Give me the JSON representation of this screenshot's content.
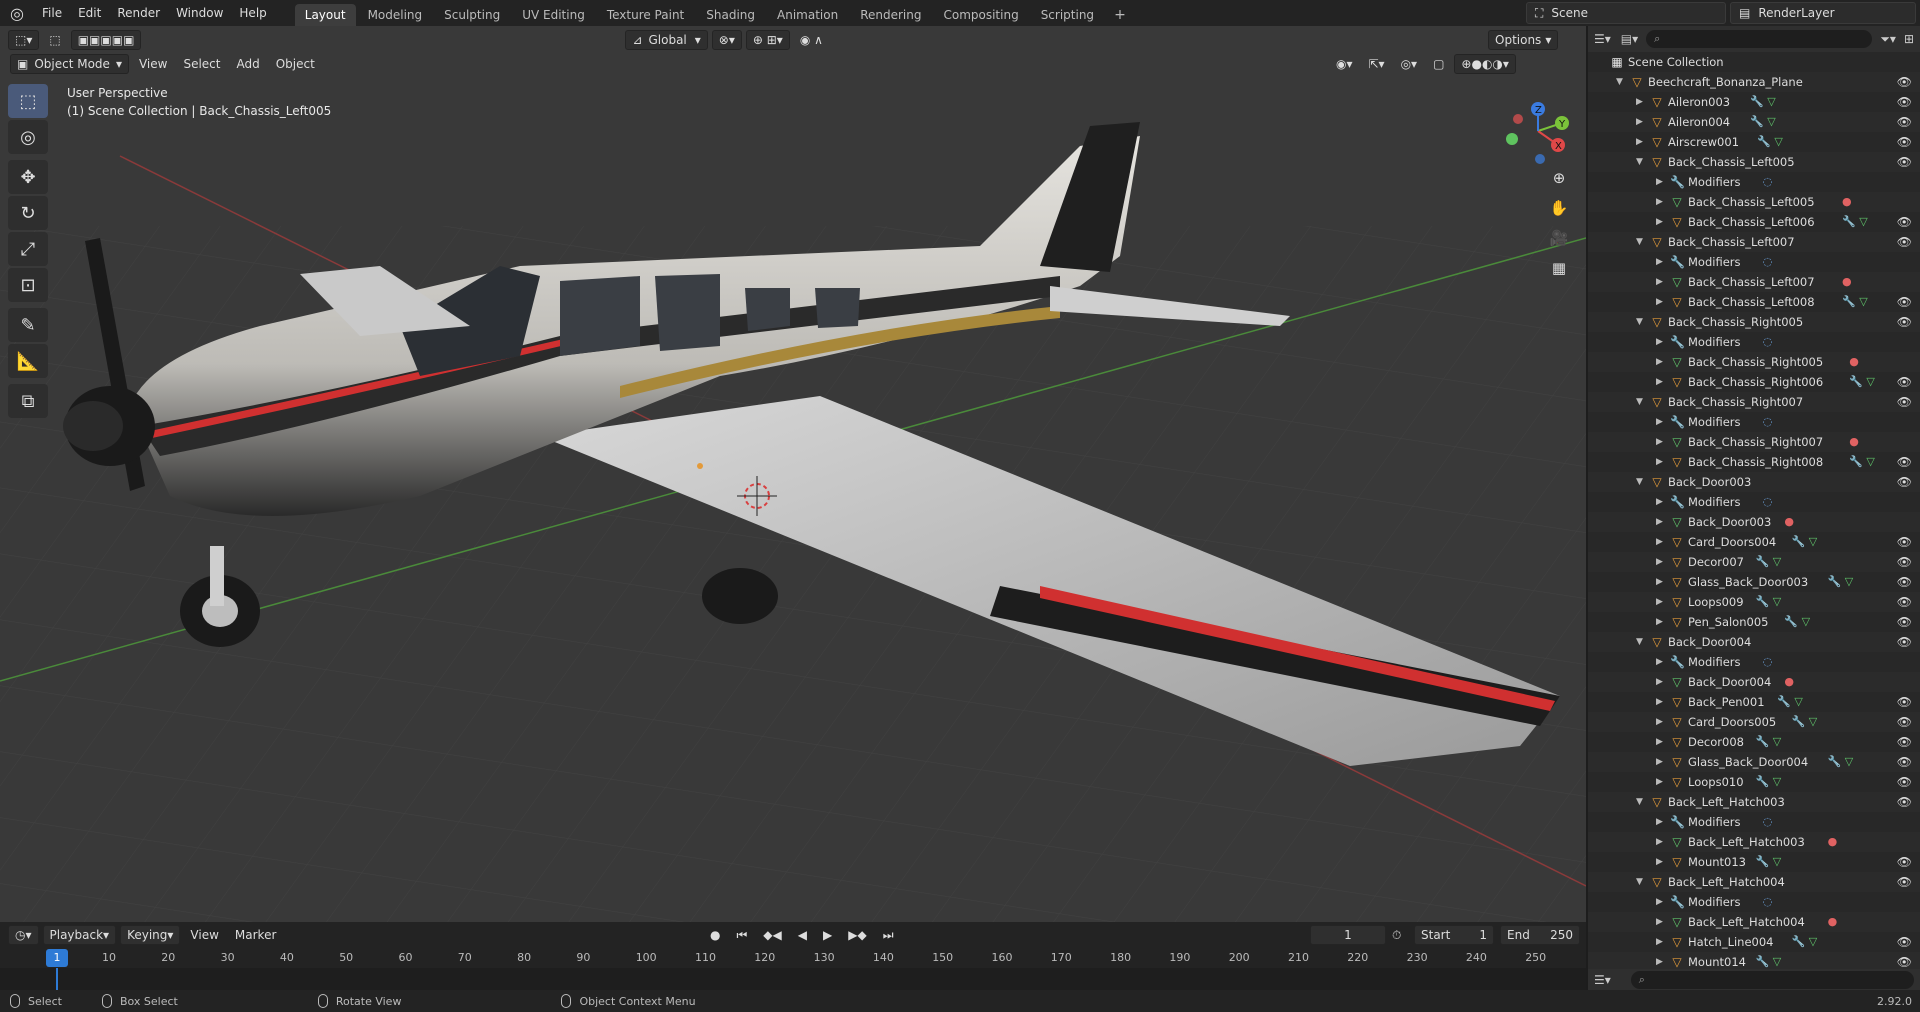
{
  "topbar": {
    "menus": [
      "File",
      "Edit",
      "Render",
      "Window",
      "Help"
    ],
    "workspaces": [
      "Layout",
      "Modeling",
      "Sculpting",
      "UV Editing",
      "Texture Paint",
      "Shading",
      "Animation",
      "Rendering",
      "Compositing",
      "Scripting"
    ],
    "active_workspace": "Layout",
    "scene": "Scene",
    "render_layer": "RenderLayer"
  },
  "viewport": {
    "mode": "Object Mode",
    "menus": [
      "View",
      "Select",
      "Add",
      "Object"
    ],
    "transform_orientation": "Global",
    "options_label": "Options",
    "perspective_label": "User Perspective",
    "context_label": "(1) Scene Collection | Back_Chassis_Left005",
    "gizmo_axes": [
      "X",
      "Y",
      "Z"
    ]
  },
  "outliner": {
    "search_placeholder": "",
    "rows": [
      {
        "depth": 0,
        "type": "coll",
        "expand": "",
        "label": "Scene Collection",
        "eye": false,
        "mods": ""
      },
      {
        "depth": 1,
        "type": "obj",
        "expand": "open",
        "label": "Beechcraft_Bonanza_Plane",
        "eye": true,
        "mods": ""
      },
      {
        "depth": 2,
        "type": "obj",
        "expand": "closed",
        "label": "Aileron003",
        "eye": true,
        "mods": "wrench+mesh"
      },
      {
        "depth": 2,
        "type": "obj",
        "expand": "closed",
        "label": "Aileron004",
        "eye": true,
        "mods": "wrench+mesh"
      },
      {
        "depth": 2,
        "type": "obj",
        "expand": "closed",
        "label": "Airscrew001",
        "eye": true,
        "mods": "wrench+mesh"
      },
      {
        "depth": 2,
        "type": "obj",
        "expand": "open",
        "label": "Back_Chassis_Left005",
        "eye": true,
        "mods": ""
      },
      {
        "depth": 3,
        "type": "mod",
        "expand": "closed",
        "label": "Modifiers",
        "eye": false,
        "mods": "mod"
      },
      {
        "depth": 3,
        "type": "mesh",
        "expand": "closed",
        "label": "Back_Chassis_Left005",
        "eye": false,
        "mods": "mat"
      },
      {
        "depth": 3,
        "type": "obj",
        "expand": "closed",
        "label": "Back_Chassis_Left006",
        "eye": true,
        "mods": "wrench+mesh"
      },
      {
        "depth": 2,
        "type": "obj",
        "expand": "open",
        "label": "Back_Chassis_Left007",
        "eye": true,
        "mods": ""
      },
      {
        "depth": 3,
        "type": "mod",
        "expand": "closed",
        "label": "Modifiers",
        "eye": false,
        "mods": "mod"
      },
      {
        "depth": 3,
        "type": "mesh",
        "expand": "closed",
        "label": "Back_Chassis_Left007",
        "eye": false,
        "mods": "mat"
      },
      {
        "depth": 3,
        "type": "obj",
        "expand": "closed",
        "label": "Back_Chassis_Left008",
        "eye": true,
        "mods": "wrench+mesh"
      },
      {
        "depth": 2,
        "type": "obj",
        "expand": "open",
        "label": "Back_Chassis_Right005",
        "eye": true,
        "mods": ""
      },
      {
        "depth": 3,
        "type": "mod",
        "expand": "closed",
        "label": "Modifiers",
        "eye": false,
        "mods": "mod"
      },
      {
        "depth": 3,
        "type": "mesh",
        "expand": "closed",
        "label": "Back_Chassis_Right005",
        "eye": false,
        "mods": "mat"
      },
      {
        "depth": 3,
        "type": "obj",
        "expand": "closed",
        "label": "Back_Chassis_Right006",
        "eye": true,
        "mods": "wrench+mesh"
      },
      {
        "depth": 2,
        "type": "obj",
        "expand": "open",
        "label": "Back_Chassis_Right007",
        "eye": true,
        "mods": ""
      },
      {
        "depth": 3,
        "type": "mod",
        "expand": "closed",
        "label": "Modifiers",
        "eye": false,
        "mods": "mod"
      },
      {
        "depth": 3,
        "type": "mesh",
        "expand": "closed",
        "label": "Back_Chassis_Right007",
        "eye": false,
        "mods": "mat"
      },
      {
        "depth": 3,
        "type": "obj",
        "expand": "closed",
        "label": "Back_Chassis_Right008",
        "eye": true,
        "mods": "wrench+mesh"
      },
      {
        "depth": 2,
        "type": "obj",
        "expand": "open",
        "label": "Back_Door003",
        "eye": true,
        "mods": ""
      },
      {
        "depth": 3,
        "type": "mod",
        "expand": "closed",
        "label": "Modifiers",
        "eye": false,
        "mods": "mod"
      },
      {
        "depth": 3,
        "type": "mesh",
        "expand": "closed",
        "label": "Back_Door003",
        "eye": false,
        "mods": "mat"
      },
      {
        "depth": 3,
        "type": "obj",
        "expand": "closed",
        "label": "Card_Doors004",
        "eye": true,
        "mods": "wrench+mesh"
      },
      {
        "depth": 3,
        "type": "obj",
        "expand": "closed",
        "label": "Decor007",
        "eye": true,
        "mods": "wrench+mesh"
      },
      {
        "depth": 3,
        "type": "obj",
        "expand": "closed",
        "label": "Glass_Back_Door003",
        "eye": true,
        "mods": "wrench+mesh"
      },
      {
        "depth": 3,
        "type": "obj",
        "expand": "closed",
        "label": "Loops009",
        "eye": true,
        "mods": "wrench+mesh"
      },
      {
        "depth": 3,
        "type": "obj",
        "expand": "closed",
        "label": "Pen_Salon005",
        "eye": true,
        "mods": "wrench+mesh"
      },
      {
        "depth": 2,
        "type": "obj",
        "expand": "open",
        "label": "Back_Door004",
        "eye": true,
        "mods": ""
      },
      {
        "depth": 3,
        "type": "mod",
        "expand": "closed",
        "label": "Modifiers",
        "eye": false,
        "mods": "mod"
      },
      {
        "depth": 3,
        "type": "mesh",
        "expand": "closed",
        "label": "Back_Door004",
        "eye": false,
        "mods": "mat"
      },
      {
        "depth": 3,
        "type": "obj",
        "expand": "closed",
        "label": "Back_Pen001",
        "eye": true,
        "mods": "wrench+mesh"
      },
      {
        "depth": 3,
        "type": "obj",
        "expand": "closed",
        "label": "Card_Doors005",
        "eye": true,
        "mods": "wrench+mesh"
      },
      {
        "depth": 3,
        "type": "obj",
        "expand": "closed",
        "label": "Decor008",
        "eye": true,
        "mods": "wrench+mesh"
      },
      {
        "depth": 3,
        "type": "obj",
        "expand": "closed",
        "label": "Glass_Back_Door004",
        "eye": true,
        "mods": "wrench+mesh"
      },
      {
        "depth": 3,
        "type": "obj",
        "expand": "closed",
        "label": "Loops010",
        "eye": true,
        "mods": "wrench+mesh"
      },
      {
        "depth": 2,
        "type": "obj",
        "expand": "open",
        "label": "Back_Left_Hatch003",
        "eye": true,
        "mods": ""
      },
      {
        "depth": 3,
        "type": "mod",
        "expand": "closed",
        "label": "Modifiers",
        "eye": false,
        "mods": "mod"
      },
      {
        "depth": 3,
        "type": "mesh",
        "expand": "closed",
        "label": "Back_Left_Hatch003",
        "eye": false,
        "mods": "mat"
      },
      {
        "depth": 3,
        "type": "obj",
        "expand": "closed",
        "label": "Mount013",
        "eye": true,
        "mods": "wrench+mesh"
      },
      {
        "depth": 2,
        "type": "obj",
        "expand": "open",
        "label": "Back_Left_Hatch004",
        "eye": true,
        "mods": ""
      },
      {
        "depth": 3,
        "type": "mod",
        "expand": "closed",
        "label": "Modifiers",
        "eye": false,
        "mods": "mod"
      },
      {
        "depth": 3,
        "type": "mesh",
        "expand": "closed",
        "label": "Back_Left_Hatch004",
        "eye": false,
        "mods": "mat"
      },
      {
        "depth": 3,
        "type": "obj",
        "expand": "closed",
        "label": "Hatch_Line004",
        "eye": true,
        "mods": "wrench+mesh"
      },
      {
        "depth": 3,
        "type": "obj",
        "expand": "closed",
        "label": "Mount014",
        "eye": true,
        "mods": "wrench+mesh"
      }
    ]
  },
  "timeline": {
    "menus": [
      "Playback",
      "Keying",
      "View",
      "Marker"
    ],
    "current_frame": "1",
    "start_label": "Start",
    "start": "1",
    "end_label": "End",
    "end": "250",
    "ticks": [
      "10",
      "20",
      "30",
      "40",
      "50",
      "60",
      "70",
      "80",
      "90",
      "100",
      "110",
      "120",
      "130",
      "140",
      "150",
      "160",
      "170",
      "180",
      "190",
      "200",
      "210",
      "220",
      "230",
      "240",
      "250"
    ],
    "cursor_label": "1"
  },
  "status": {
    "items": [
      "Select",
      "Box Select",
      "Rotate View",
      "Object Context Menu"
    ],
    "version": "2.92.0"
  },
  "colors": {
    "accent": "#2e7bd6",
    "object_orange": "#e39a3a",
    "mesh_green": "#5fc36a",
    "axis_x": "#e04848",
    "axis_y": "#7bc33a",
    "axis_z": "#3a7be0"
  }
}
